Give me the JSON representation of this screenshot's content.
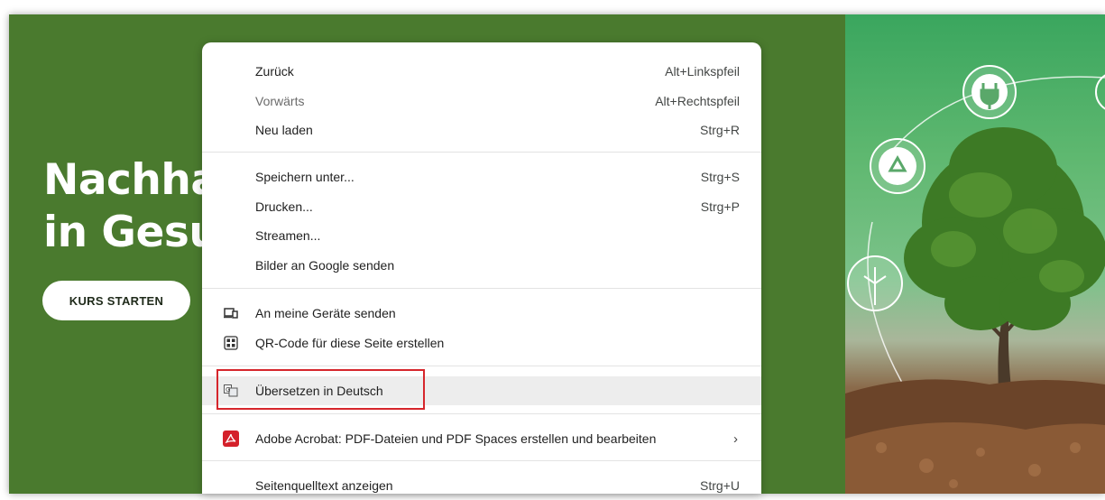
{
  "hero": {
    "title": "Nachha\nin Gesu",
    "cta_label": "KURS STARTEN"
  },
  "context_menu": {
    "back": {
      "label": "Zurück",
      "shortcut": "Alt+Linkspfeil"
    },
    "forward": {
      "label": "Vorwärts",
      "shortcut": "Alt+Rechtspfeil"
    },
    "reload": {
      "label": "Neu laden",
      "shortcut": "Strg+R"
    },
    "save_as": {
      "label": "Speichern unter...",
      "shortcut": "Strg+S"
    },
    "print": {
      "label": "Drucken...",
      "shortcut": "Strg+P"
    },
    "cast": {
      "label": "Streamen..."
    },
    "search_images": {
      "label": "Bilder an Google senden"
    },
    "send_to_devices": {
      "label": "An meine Geräte senden",
      "icon": "devices-icon"
    },
    "qr_code": {
      "label": "QR-Code für diese Seite erstellen",
      "icon": "qr-code-icon"
    },
    "translate": {
      "label": "Übersetzen in Deutsch",
      "icon": "translate-icon"
    },
    "acrobat": {
      "label": "Adobe Acrobat: PDF-Dateien und PDF Spaces erstellen und bearbeiten",
      "icon": "adobe-acrobat-icon",
      "submenu": "›"
    },
    "view_source": {
      "label": "Seitenquelltext anzeigen",
      "shortcut": "Strg+U"
    }
  },
  "colors": {
    "hero_green": "#4a7a2e",
    "highlight_red": "#d6262c",
    "acrobat_red": "#d4202a"
  }
}
